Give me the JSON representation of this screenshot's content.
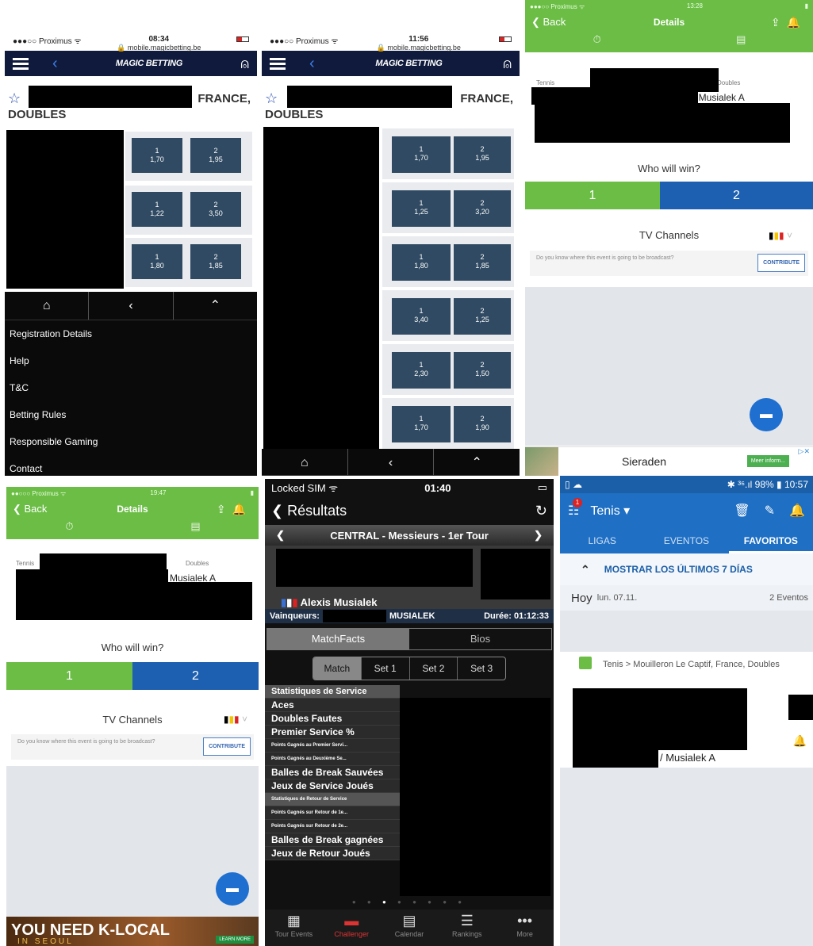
{
  "magic1": {
    "carrier": "●●●○○ Proximus ᯤ",
    "time": "08:34",
    "url": "🔒 mobile.magicbetting.be",
    "brand": "MAGIC BETTING",
    "title_right": "FRANCE,",
    "title_left": "DOUBLES",
    "odds": [
      {
        "a": "1",
        "av": "1,70",
        "b": "2",
        "bv": "1,95"
      },
      {
        "a": "1",
        "av": "1,22",
        "b": "2",
        "bv": "3,50"
      },
      {
        "a": "1",
        "av": "1,80",
        "b": "2",
        "bv": "1,85"
      }
    ],
    "menu": [
      "Registration Details",
      "Help",
      "T&C",
      "Betting Rules",
      "Responsible Gaming",
      "Contact"
    ]
  },
  "magic2": {
    "carrier": "●●●○○ Proximus ᯤ",
    "time": "11:56",
    "url": "🔒 mobile.magicbetting.be",
    "brand": "MAGIC BETTING",
    "title_right": "FRANCE,",
    "title_left": "DOUBLES",
    "odds": [
      {
        "a": "1",
        "av": "1,70",
        "b": "2",
        "bv": "1,95"
      },
      {
        "a": "1",
        "av": "1,25",
        "b": "2",
        "bv": "3,20"
      },
      {
        "a": "1",
        "av": "1,80",
        "b": "2",
        "bv": "1,85"
      },
      {
        "a": "1",
        "av": "3,40",
        "b": "2",
        "bv": "1,25"
      },
      {
        "a": "1",
        "av": "2,30",
        "b": "2",
        "bv": "1,50"
      },
      {
        "a": "1",
        "av": "1,70",
        "b": "2",
        "bv": "1,90"
      }
    ]
  },
  "details1": {
    "carrier": "●●●○○ Proximus ᯤ",
    "time": "13:28",
    "back": "❮ Back",
    "title": "Details",
    "sport": "Tennis",
    "type": "Doubles",
    "player": "/ Musialek A",
    "who": "Who will win?",
    "vote1": "1",
    "vote2": "2",
    "tv": "TV Channels",
    "question": "Do you know where this event is going to be broadcast?",
    "contribute": "CONTRIBUTE",
    "ad_text": "Sieraden",
    "ad_btn": "Meer inform..."
  },
  "details2": {
    "carrier": "●●○○○ Proximus ᯤ",
    "time": "19:47",
    "back": "❮ Back",
    "title": "Details",
    "sport": "Tennis",
    "type": "Doubles",
    "player": "Musialek A",
    "who": "Who will win?",
    "vote1": "1",
    "vote2": "2",
    "tv": "TV Channels",
    "question": "Do you know where this event is going to be broadcast?",
    "contribute": "CONTRIBUTE",
    "ad_text": "YOU NEED K-LOCAL",
    "ad_sub": "IN SEOUL",
    "ad_btn": "LEARN MORE"
  },
  "resultats": {
    "carrier": "Locked SIM ᯤ",
    "time": "01:40",
    "back": "❮ Résultats",
    "court": "CENTRAL - Messieurs - 1er Tour",
    "player": "Alexis Musialek",
    "winners_label": "Vainqueurs:",
    "winner": "MUSIALEK",
    "duration": "Durée: 01:12:33",
    "tab1": "MatchFacts",
    "tab2": "Bios",
    "sets": [
      "Match",
      "Set 1",
      "Set 2",
      "Set 3"
    ],
    "stats": [
      "Statistiques de Service",
      "Aces",
      "Doubles Fautes",
      "Premier Service %",
      "Points Gagnés au Premier Servi...",
      "Points Gagnés au Deuxième Se...",
      "Balles de Break Sauvées",
      "Jeux de Service Joués",
      "Statistiques de Retour de Service",
      "Points Gagnés sur Retour de 1e...",
      "Points Gagnés sur Retour de 2e...",
      "Balles de Break gagnées",
      "Jeux de Retour Joués"
    ],
    "tabbar": [
      "Tour Events",
      "Challenger",
      "Calendar",
      "Rankings",
      "More"
    ]
  },
  "tenis": {
    "status_right": "✱ ³⁶.ıl 98% ▮ 10:57",
    "title": "Tenis ▾",
    "badge": "1",
    "tabs": [
      "LIGAS",
      "EVENTOS",
      "FAVORITOS"
    ],
    "show": "MOSTRAR LOS ÚLTIMOS 7 DÍAS",
    "day": "Hoy",
    "date": "lun. 07.11.",
    "events": "2 Eventos",
    "league": "Tenis > Mouilleron Le Captif, France, Doubles",
    "player": "/ Musialek A"
  }
}
